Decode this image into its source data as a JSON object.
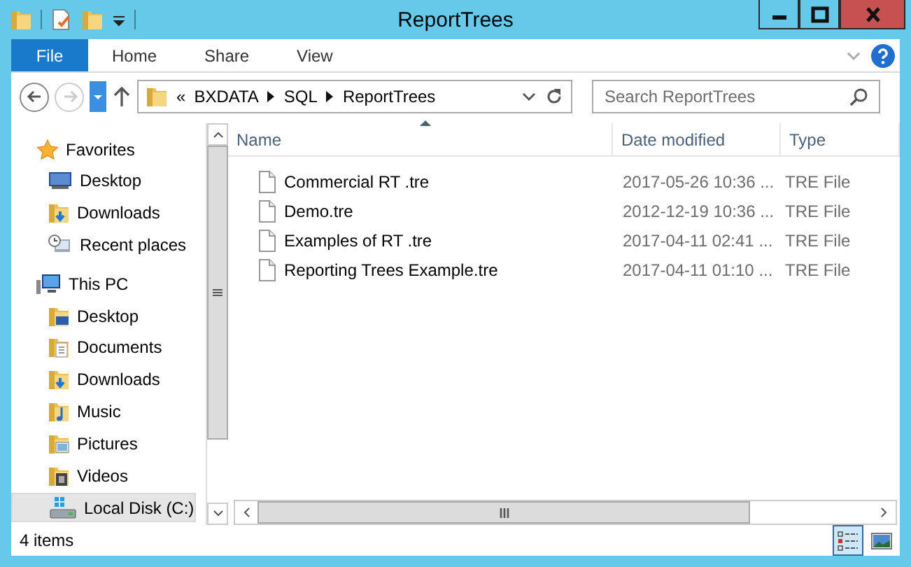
{
  "window": {
    "title": "ReportTrees"
  },
  "ribbon_tabs": [
    {
      "label": "File",
      "kind": "file",
      "selected": false
    },
    {
      "label": "Home",
      "kind": "tab",
      "selected": false
    },
    {
      "label": "Share",
      "kind": "tab",
      "selected": false
    },
    {
      "label": "View",
      "kind": "tab",
      "selected": false
    }
  ],
  "address_bar": {
    "overflow": "«",
    "segments": [
      "BXDATA",
      "SQL",
      "ReportTrees"
    ]
  },
  "search": {
    "placeholder": "Search ReportTrees"
  },
  "navigation": [
    {
      "label": "Favorites",
      "kind": "favorites",
      "selected": false,
      "children": [
        {
          "label": "Desktop",
          "kind": "desktop",
          "selected": false
        },
        {
          "label": "Downloads",
          "kind": "downloads",
          "selected": false
        },
        {
          "label": "Recent places",
          "kind": "recent",
          "selected": false
        }
      ]
    },
    {
      "label": "This PC",
      "kind": "pc",
      "selected": false,
      "children": [
        {
          "label": "Desktop",
          "kind": "desktop-folder",
          "selected": false
        },
        {
          "label": "Documents",
          "kind": "documents",
          "selected": false
        },
        {
          "label": "Downloads",
          "kind": "downloads",
          "selected": false
        },
        {
          "label": "Music",
          "kind": "music",
          "selected": false
        },
        {
          "label": "Pictures",
          "kind": "pictures",
          "selected": false
        },
        {
          "label": "Videos",
          "kind": "videos",
          "selected": false
        },
        {
          "label": "Local Disk (C:)",
          "kind": "disk",
          "selected": true
        }
      ]
    }
  ],
  "table": {
    "columns": [
      {
        "label": "Name",
        "sorted": true
      },
      {
        "label": "Date modified",
        "sorted": false
      },
      {
        "label": "Type",
        "sorted": false
      }
    ],
    "rows": [
      {
        "name": "Commercial RT .tre",
        "date_modified": "2017-05-26 10:36 ...",
        "type": "TRE File"
      },
      {
        "name": "Demo.tre",
        "date_modified": "2012-12-19 10:36 ...",
        "type": "TRE File"
      },
      {
        "name": "Examples of RT .tre",
        "date_modified": "2017-04-11 02:41 ...",
        "type": "TRE File"
      },
      {
        "name": "Reporting Trees Example.tre",
        "date_modified": "2017-04-11 01:10 ...",
        "type": "TRE File"
      }
    ]
  },
  "status_bar": {
    "text": "4 items"
  },
  "view_buttons": [
    {
      "kind": "details",
      "selected": true
    },
    {
      "kind": "large-icons",
      "selected": false
    }
  ]
}
